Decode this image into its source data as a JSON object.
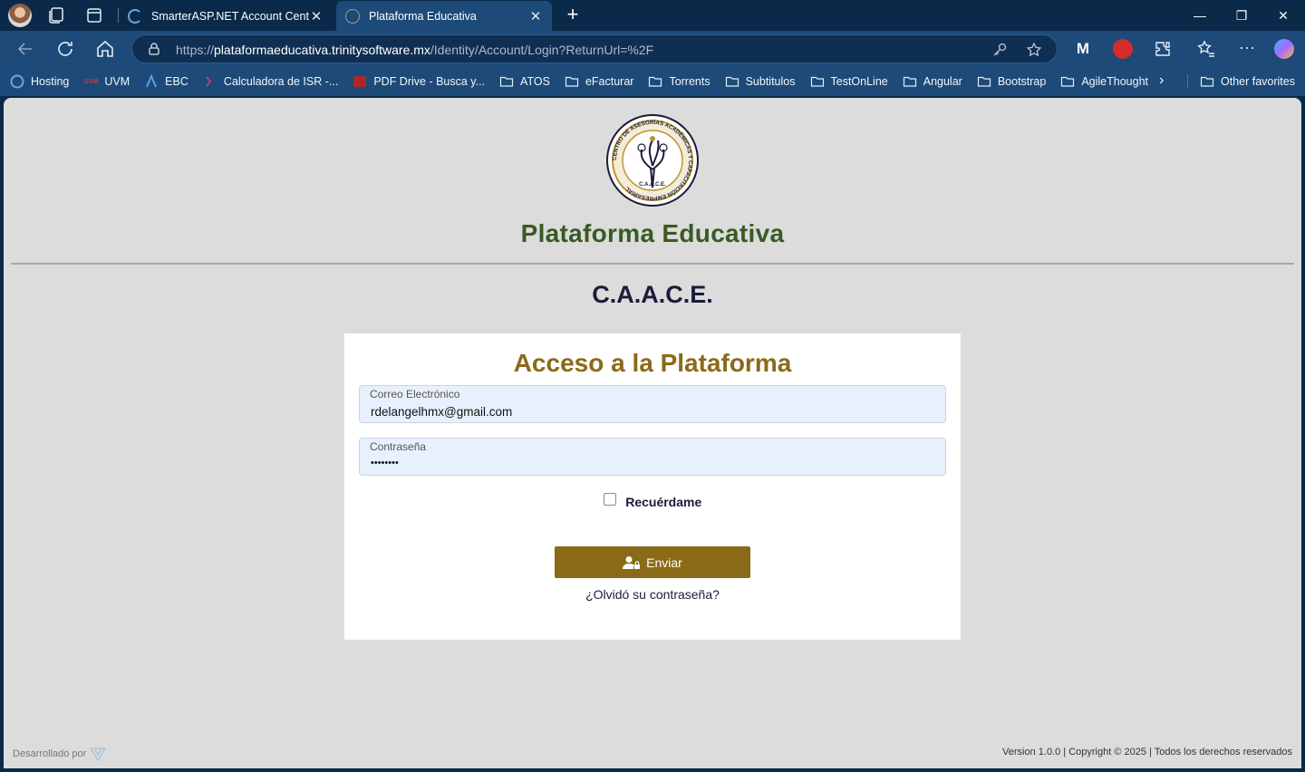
{
  "browser": {
    "tabs": [
      {
        "title": "SmarterASP.NET Account Center",
        "active": false
      },
      {
        "title": "Plataforma Educativa",
        "active": true
      }
    ],
    "url": {
      "prefix": "https://",
      "host": "plataformaeducativa.trinitysoftware.mx",
      "path": "/Identity/Account/Login?ReturnUrl=%2F"
    },
    "bookmarks": [
      {
        "label": "Hosting",
        "icon": "hosting-icon"
      },
      {
        "label": "UVM",
        "icon": "uvm-icon"
      },
      {
        "label": "EBC",
        "icon": "ebc-icon"
      },
      {
        "label": "Calculadora de ISR -...",
        "icon": "calculator-icon"
      },
      {
        "label": "PDF Drive - Busca y...",
        "icon": "pdf-icon"
      },
      {
        "label": "ATOS",
        "icon": "folder-icon"
      },
      {
        "label": "eFacturar",
        "icon": "folder-icon"
      },
      {
        "label": "Torrents",
        "icon": "folder-icon"
      },
      {
        "label": "Subtitulos",
        "icon": "folder-icon"
      },
      {
        "label": "TestOnLine",
        "icon": "folder-icon"
      },
      {
        "label": "Angular",
        "icon": "folder-icon"
      },
      {
        "label": "Bootstrap",
        "icon": "folder-icon"
      },
      {
        "label": "AgileThought",
        "icon": "folder-icon"
      }
    ],
    "other_favorites": "Other favorites"
  },
  "page": {
    "logo_text": "CENTRO DE ASESORÍAS ACADÉMICAS Y CAPACITACIÓN EMPRESARIAL",
    "logo_abbr": "C.A.A.C.E.",
    "site_title": "Plataforma Educativa",
    "org_name": "C.A.A.C.E.",
    "login": {
      "title": "Acceso a la Plataforma",
      "email_label": "Correo Electrónico",
      "email_value": "rdelangelhmx@gmail.com",
      "password_label": "Contraseña",
      "password_value": "••••••••",
      "remember_label": "Recuérdame",
      "remember_checked": false,
      "submit_label": "Enviar",
      "forgot_label": "¿Olvidó su contraseña?"
    },
    "footer": {
      "developed_by": "Desarrollado por",
      "copyright": "Version 1.0.0 | Copyright © 2025 | Todos los derechos reservados"
    }
  },
  "colors": {
    "accent_gold": "#8a6a17",
    "title_green": "#3a5a24",
    "browser_dark": "#0b2a4a",
    "browser_toolbar": "#1d4a78"
  }
}
